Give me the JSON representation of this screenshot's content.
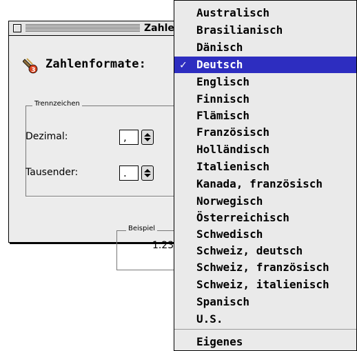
{
  "window": {
    "title": "Zahle",
    "heading": "Zahlenformate:",
    "separators_group": {
      "legend": "Trennzeichen",
      "decimal_label": "Dezimal:",
      "decimal_value": ",",
      "thousands_label": "Tausender:",
      "thousands_value": "."
    },
    "example": {
      "legend": "Beispiel",
      "value": "1.23"
    }
  },
  "menu": {
    "items": [
      {
        "label": "Australisch"
      },
      {
        "label": "Brasilianisch"
      },
      {
        "label": "Dänisch"
      },
      {
        "label": "Deutsch",
        "checked": true
      },
      {
        "label": "Englisch"
      },
      {
        "label": "Finnisch"
      },
      {
        "label": "Flämisch"
      },
      {
        "label": "Französisch"
      },
      {
        "label": "Holländisch"
      },
      {
        "label": "Italienisch"
      },
      {
        "label": "Kanada, französisch"
      },
      {
        "label": "Norwegisch"
      },
      {
        "label": "Österreichisch"
      },
      {
        "label": "Schwedisch"
      },
      {
        "label": "Schweiz, deutsch"
      },
      {
        "label": "Schweiz, französisch"
      },
      {
        "label": "Schweiz, italienisch"
      },
      {
        "label": "Spanisch"
      },
      {
        "label": "U.S."
      }
    ],
    "custom_item": "Eigenes",
    "check_mark": "✓"
  }
}
